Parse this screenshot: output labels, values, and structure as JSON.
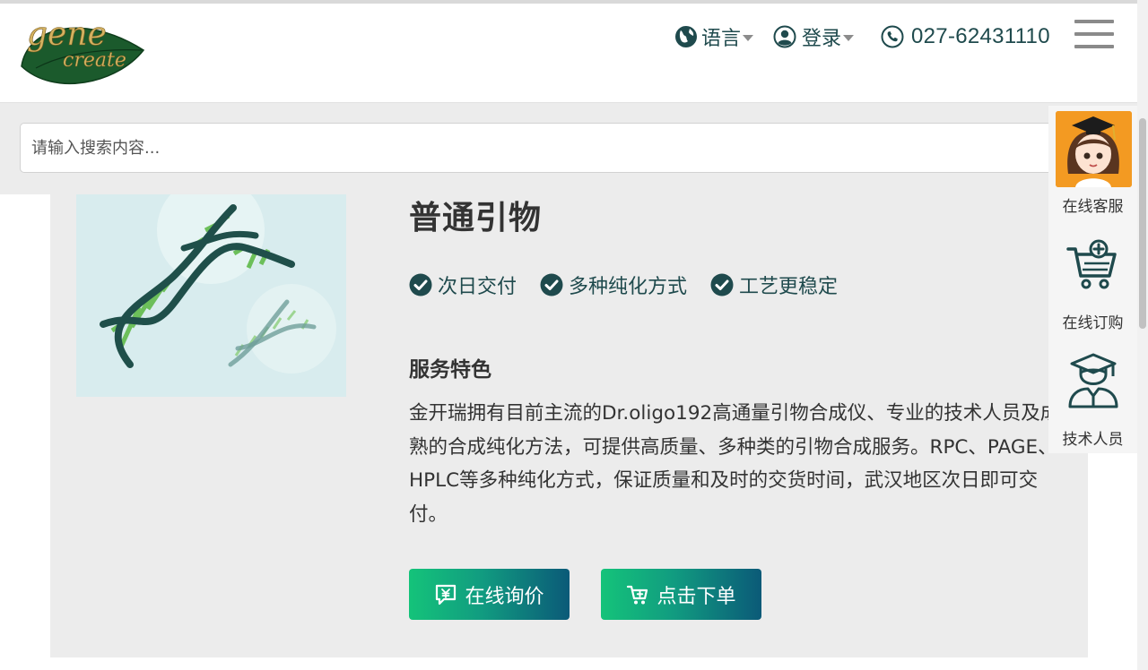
{
  "header": {
    "logo_text_top": "gene",
    "logo_text_bottom": "create",
    "language_label": "语言",
    "login_label": "登录",
    "phone": "027-62431110"
  },
  "search": {
    "placeholder": "请输入搜索内容..."
  },
  "product": {
    "title": "普通引物",
    "features": [
      "次日交付",
      "多种纯化方式",
      "工艺更稳定"
    ],
    "section_title": "服务特色",
    "description": "金开瑞拥有目前主流的Dr.oligo192高通量引物合成仪、专业的技术人员及成熟的合成纯化方法，可提供高质量、多种类的引物合成服务。RPC、PAGE、HPLC等多种纯化方式，保证质量和及时的交货时间，武汉地区次日即可交付。",
    "buttons": {
      "inquiry": "在线询价",
      "order": "点击下单"
    }
  },
  "floating_panel": {
    "items": [
      {
        "label": "在线客服",
        "icon": "customer-service-avatar"
      },
      {
        "label": "在线订购",
        "icon": "cart-plus-icon"
      },
      {
        "label": "技术人员",
        "icon": "graduate-icon"
      }
    ]
  },
  "colors": {
    "brand_teal": "#1f4a4d",
    "button_start": "#14c37a",
    "button_end": "#0b5a78",
    "card_bg": "#ececec"
  }
}
